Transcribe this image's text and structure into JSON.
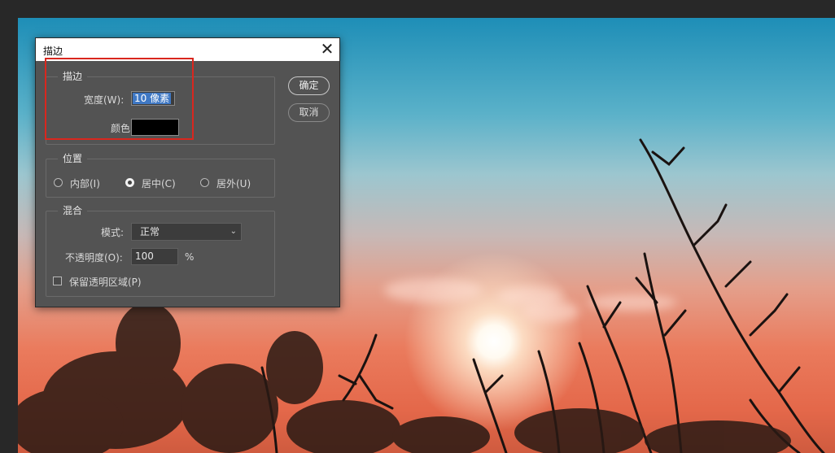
{
  "dialog": {
    "title": "描边",
    "close_icon": "close-icon",
    "stroke_group": {
      "title": "描边",
      "width_label": "宽度(W):",
      "width_value": "10 像素",
      "color_label": "颜色:",
      "color_value": "#000000"
    },
    "position_group": {
      "title": "位置",
      "options": [
        "内部(I)",
        "居中(C)",
        "居外(U)"
      ],
      "selected": "居中(C)"
    },
    "blend_group": {
      "title": "混合",
      "mode_label": "模式:",
      "mode_value": "正常",
      "opacity_label": "不透明度(O):",
      "opacity_value": "100",
      "opacity_unit": "%",
      "preserve_label": "保留透明区域(P)",
      "preserve_checked": false
    },
    "ok_label": "确定",
    "cancel_label": "取消"
  },
  "annotation": {
    "highlight_color": "#d9271e"
  }
}
